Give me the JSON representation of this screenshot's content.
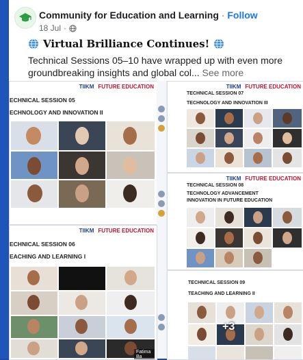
{
  "post": {
    "page_name": "Community for Education and Learning",
    "separator": "·",
    "follow_label": "Follow",
    "date": "18 Jul",
    "meta_separator": "·",
    "headline": "Virtual Brilliance Continues!",
    "body": "Technical Sessions 05–10 have wrapped up with even more groundbreaking insights and global col...",
    "see_more": "See more"
  },
  "collage": {
    "slides": [
      {
        "session": "ECHNICAL SESSION 05",
        "topic": "ECHNOLOGY AND INNOVATION II"
      },
      {
        "session": "TECHNICAL SESSION 07",
        "topic": "TECHNOLOGY AND INNOVATION III"
      },
      {
        "session": "TECHNICAL SESSION 08",
        "topic": "TECHNOLOGY ADVANCEMENT",
        "topic2": "INNOVATION IN FUTURE EDUCATION"
      },
      {
        "session": "ECHNICAL SESSION 06",
        "topic": "EACHING AND LEARNING I"
      },
      {
        "session": "TECHNICAL SESSION 09",
        "topic": "TEACHING AND LEARNING II"
      }
    ],
    "logo": "TIIKM",
    "logo2": "FUTURE EDUCATION",
    "more_count": "+3",
    "name_tag": "Fatima Ba"
  },
  "colors": {
    "accent": "#1877f2",
    "brand_blue": "#1b4aa8"
  }
}
